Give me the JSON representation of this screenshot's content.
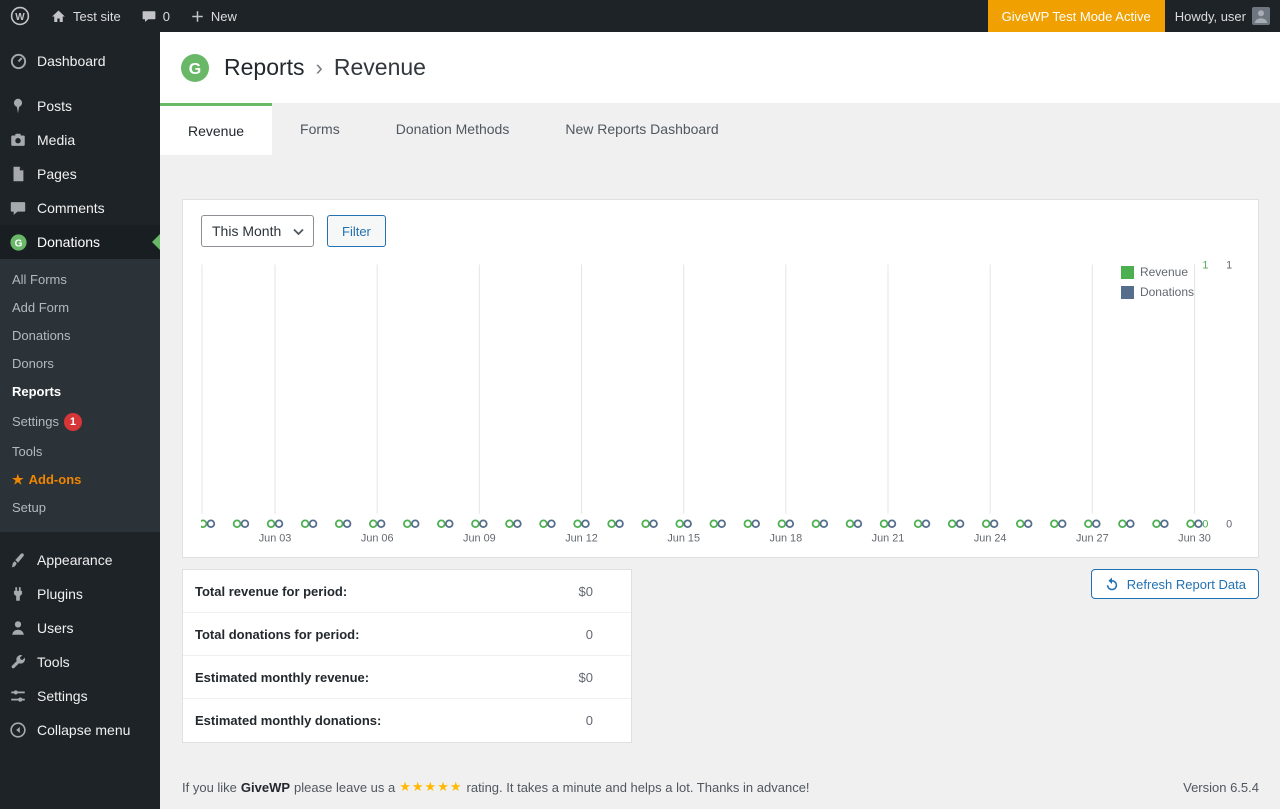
{
  "colors": {
    "accent_green": "#69b868",
    "link_blue": "#2271b1",
    "badge_red": "#d63638",
    "star_orange": "#ffb900",
    "testmode_orange": "#f0a000"
  },
  "admin_bar": {
    "wp_logo_letter": "W",
    "site_name": "Test site",
    "comments_count": "0",
    "new_label": "New",
    "test_mode_label": "GiveWP Test Mode Active",
    "howdy": "Howdy, user"
  },
  "sidebar": {
    "dashboard": "Dashboard",
    "posts": "Posts",
    "media": "Media",
    "pages": "Pages",
    "comments": "Comments",
    "donations": "Donations",
    "donations_submenu": {
      "all_forms": "All Forms",
      "add_form": "Add Form",
      "donations": "Donations",
      "donors": "Donors",
      "reports": "Reports",
      "settings": "Settings",
      "settings_badge": "1",
      "tools": "Tools",
      "addons_star": "★",
      "addons": "Add-ons",
      "setup": "Setup"
    },
    "appearance": "Appearance",
    "plugins": "Plugins",
    "users": "Users",
    "tools": "Tools",
    "settings": "Settings",
    "collapse": "Collapse menu"
  },
  "header": {
    "logo_letter": "G",
    "breadcrumb_parent": "Reports",
    "breadcrumb_separator": "›",
    "breadcrumb_current": "Revenue"
  },
  "tabs": {
    "revenue": "Revenue",
    "forms": "Forms",
    "donation_methods": "Donation Methods",
    "new_dashboard": "New Reports Dashboard"
  },
  "controls": {
    "period_select": "This Month",
    "filter_button": "Filter"
  },
  "chart_data": {
    "type": "scatter",
    "title": "",
    "xlabel": "",
    "ylabel": "",
    "x": [
      "Jun 01",
      "Jun 02",
      "Jun 03",
      "Jun 04",
      "Jun 05",
      "Jun 06",
      "Jun 07",
      "Jun 08",
      "Jun 09",
      "Jun 10",
      "Jun 11",
      "Jun 12",
      "Jun 13",
      "Jun 14",
      "Jun 15",
      "Jun 16",
      "Jun 17",
      "Jun 18",
      "Jun 19",
      "Jun 20",
      "Jun 21",
      "Jun 22",
      "Jun 23",
      "Jun 24",
      "Jun 25",
      "Jun 26",
      "Jun 27",
      "Jun 28",
      "Jun 29",
      "Jun 30"
    ],
    "x_tick_every": 3,
    "x_tick_labels": [
      "Jun 03",
      "Jun 06",
      "Jun 09",
      "Jun 12",
      "Jun 15",
      "Jun 18",
      "Jun 21",
      "Jun 24",
      "Jun 27",
      "Jun 30"
    ],
    "series": [
      {
        "name": "Revenue",
        "color": "#4caf50",
        "values": [
          0,
          0,
          0,
          0,
          0,
          0,
          0,
          0,
          0,
          0,
          0,
          0,
          0,
          0,
          0,
          0,
          0,
          0,
          0,
          0,
          0,
          0,
          0,
          0,
          0,
          0,
          0,
          0,
          0,
          0
        ]
      },
      {
        "name": "Donations",
        "color": "#556e8c",
        "values": [
          0,
          0,
          0,
          0,
          0,
          0,
          0,
          0,
          0,
          0,
          0,
          0,
          0,
          0,
          0,
          0,
          0,
          0,
          0,
          0,
          0,
          0,
          0,
          0,
          0,
          0,
          0,
          0,
          0,
          0
        ]
      }
    ],
    "ylim": [
      0,
      1
    ],
    "y_ticks": [
      1,
      0
    ],
    "grid": "vertical",
    "legend_position": "top-right"
  },
  "summary": {
    "rows": [
      {
        "label": "Total revenue for period:",
        "value": "$0"
      },
      {
        "label": "Total donations for period:",
        "value": "0"
      },
      {
        "label": "Estimated monthly revenue:",
        "value": "$0"
      },
      {
        "label": "Estimated monthly donations:",
        "value": "0"
      }
    ]
  },
  "refresh_button": "Refresh Report Data",
  "footer": {
    "pre": "If you like",
    "brand": "GiveWP",
    "mid": "please leave us a",
    "stars": "★★★★★",
    "post": "rating. It takes a minute and helps a lot. Thanks in advance!",
    "version": "Version 6.5.4"
  }
}
